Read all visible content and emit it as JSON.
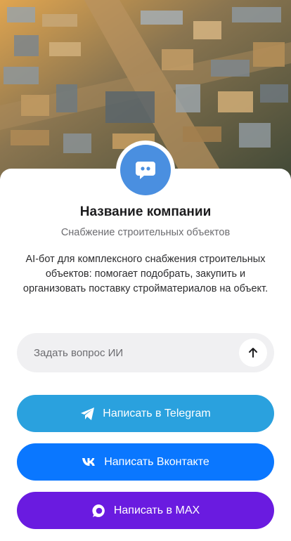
{
  "company": {
    "name": "Название компании",
    "subtitle": "Снабжение строительных объектов",
    "description": "AI-бот для комплексного снабжения строительных объектов: помогает подобрать, закупить и организовать поставку стройматериалов на объект."
  },
  "ask": {
    "placeholder": "Задать вопрос ИИ",
    "send_icon": "arrow-up-icon"
  },
  "buttons": {
    "telegram": {
      "label": "Написать в Telegram",
      "icon": "telegram-icon",
      "color": "#2aa1de"
    },
    "vk": {
      "label": "Написать Вконтакте",
      "icon": "vk-icon",
      "color": "#0a77ff"
    },
    "max": {
      "label": "Написать в MAX",
      "icon": "max-icon",
      "color": "#6a1be0"
    }
  },
  "colors": {
    "avatar": "#4a8fe0"
  }
}
